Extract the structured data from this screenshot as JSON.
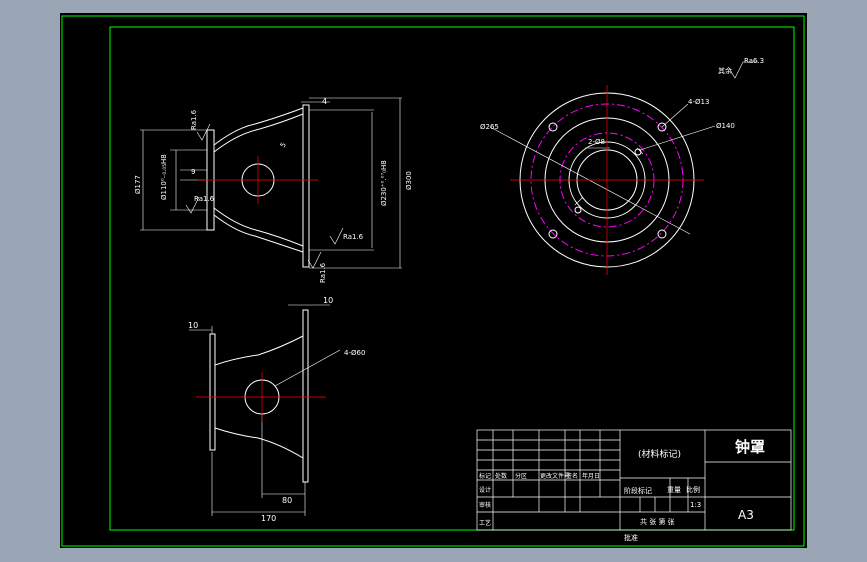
{
  "colors": {
    "background": "#9aa6b6",
    "drawing_bg": "#000000",
    "frame": "#00ff00",
    "geometry": "#ffffff",
    "centerline": "#ff0000",
    "hidden_circle": "#ff00ff"
  },
  "title_block": {
    "material_label": "(材料标记)",
    "part_name": "钟罩",
    "sheet_size": "A3",
    "row_headers": [
      "标记",
      "处数",
      "分区",
      "更改文件号",
      "签名",
      "年月日"
    ],
    "row_labels": [
      "设计",
      "审核",
      "工艺"
    ],
    "stage_label": "阶段标记",
    "weight_label": "重量",
    "scale_label": "比例",
    "scale_value": "1:3",
    "sheets_label": "共 张 第 张",
    "approve_label": "批准"
  },
  "side_view": {
    "roughness_top": "Ra1.6",
    "dim_depth": "4",
    "dim_flange_thick": "9",
    "dim_bore_left": "Ø110⁰₋₀.₀₅H8",
    "dim_outer_left": "Ø177",
    "roughness_bore": "Ra1.6",
    "dim_chamfer": "5",
    "dim_spigot": "Ø230⁺⁰.⁰⁷₀H8",
    "dim_outer_right": "Ø300",
    "roughness_face": "Ra1.6",
    "roughness_bottom": "Ra1.6"
  },
  "top_view": {
    "dim_length_top": "10",
    "dim_flange_left": "10",
    "holes_label": "4-Ø60",
    "dim_inner": "80",
    "dim_total": "170"
  },
  "front_view": {
    "general_roughness": "其余",
    "general_roughness_val": "Ra6.3",
    "bolt_circle": "Ø265",
    "holes_label": "4-Ø13",
    "pin_holes_label": "2-Ø8",
    "inner_circle": "Ø140"
  }
}
